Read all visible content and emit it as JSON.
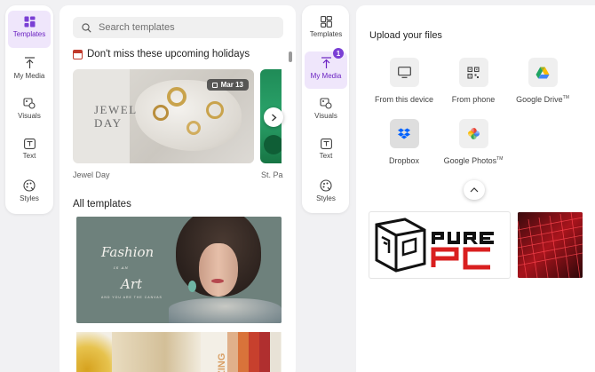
{
  "left_rail": {
    "items": [
      {
        "label": "Templates",
        "icon": "templates-icon",
        "active": true
      },
      {
        "label": "My Media",
        "icon": "upload-icon",
        "active": false
      },
      {
        "label": "Visuals",
        "icon": "visuals-icon",
        "active": false
      },
      {
        "label": "Text",
        "icon": "text-icon",
        "active": false
      },
      {
        "label": "Styles",
        "icon": "styles-icon",
        "active": false
      }
    ]
  },
  "templates_panel": {
    "search_placeholder": "Search templates",
    "holiday_heading": "Don't miss these upcoming holidays",
    "featured": [
      {
        "name": "Jewel Day",
        "card_text_line1": "JEWEL",
        "card_text_line2": "DAY",
        "date": "Mar 13"
      },
      {
        "name": "St. Pa"
      }
    ],
    "all_templates_heading": "All templates",
    "fashion_card": {
      "line1": "Fashion",
      "line2": "IS AN",
      "line3": "Art",
      "tagline": "AND YOU ARE THE CANVAS"
    },
    "zing_card": {
      "text": "ZING"
    }
  },
  "mid_rail": {
    "badge": "1",
    "items": [
      {
        "label": "Templates",
        "icon": "templates-icon",
        "active": false
      },
      {
        "label": "My Media",
        "icon": "upload-icon",
        "active": true
      },
      {
        "label": "Visuals",
        "icon": "visuals-icon",
        "active": false
      },
      {
        "label": "Text",
        "icon": "text-icon",
        "active": false
      },
      {
        "label": "Styles",
        "icon": "styles-icon",
        "active": false
      }
    ]
  },
  "upload_panel": {
    "title": "Upload your files",
    "sources": [
      {
        "label": "From this device",
        "icon": "monitor-icon"
      },
      {
        "label": "From phone",
        "icon": "qr-code-icon"
      },
      {
        "label": "Google Drive",
        "tm": "TM",
        "icon": "google-drive-icon"
      },
      {
        "label": "Dropbox",
        "icon": "dropbox-icon"
      },
      {
        "label": "Google Photos",
        "tm": "TM",
        "icon": "google-photos-icon"
      }
    ],
    "media": [
      {
        "alt": "PurePC logo",
        "logo_text": "PURE PC"
      },
      {
        "alt": "Red keyboard photo"
      }
    ]
  },
  "colors": {
    "accent": "#7a3fd4",
    "active_bg": "#efe6fb",
    "background": "#f1f1f3"
  }
}
